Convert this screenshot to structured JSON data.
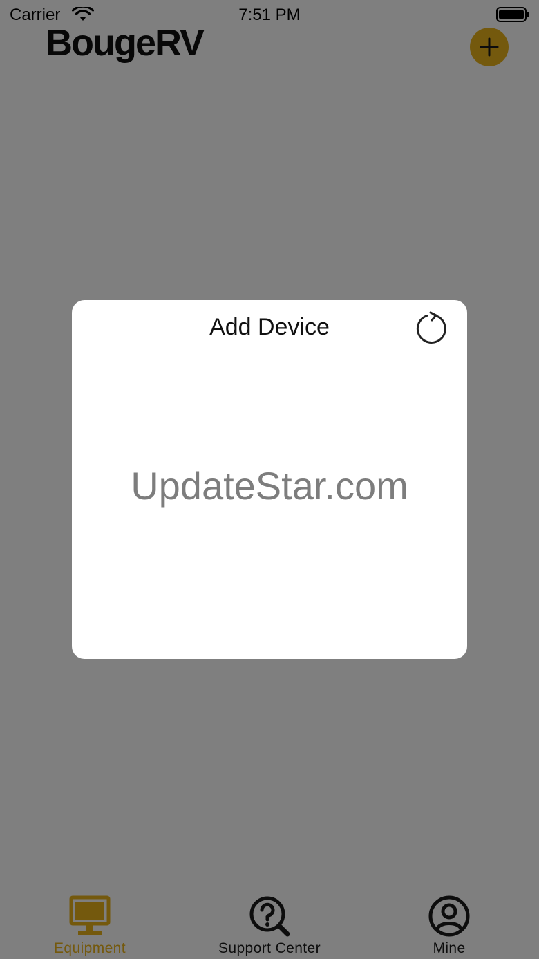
{
  "status_bar": {
    "carrier": "Carrier",
    "time": "7:51 PM",
    "icons": [
      "wifi-icon",
      "battery-icon"
    ]
  },
  "header": {
    "logo_text": "BougeRV",
    "add_button_icon": "plus-icon"
  },
  "dialog": {
    "title": "Add Device",
    "refresh_icon": "refresh-icon",
    "watermark": "UpdateStar.com"
  },
  "tab_bar": {
    "tabs": [
      {
        "label": "Equipment",
        "icon": "monitor-icon",
        "active": true
      },
      {
        "label": "Support Center",
        "icon": "question-search-icon",
        "active": false
      },
      {
        "label": "Mine",
        "icon": "user-circle-icon",
        "active": false
      }
    ]
  },
  "colors": {
    "accent": "#e9b21a",
    "overlay": "rgba(0,0,0,0.5)",
    "dialog_bg": "#ffffff"
  }
}
